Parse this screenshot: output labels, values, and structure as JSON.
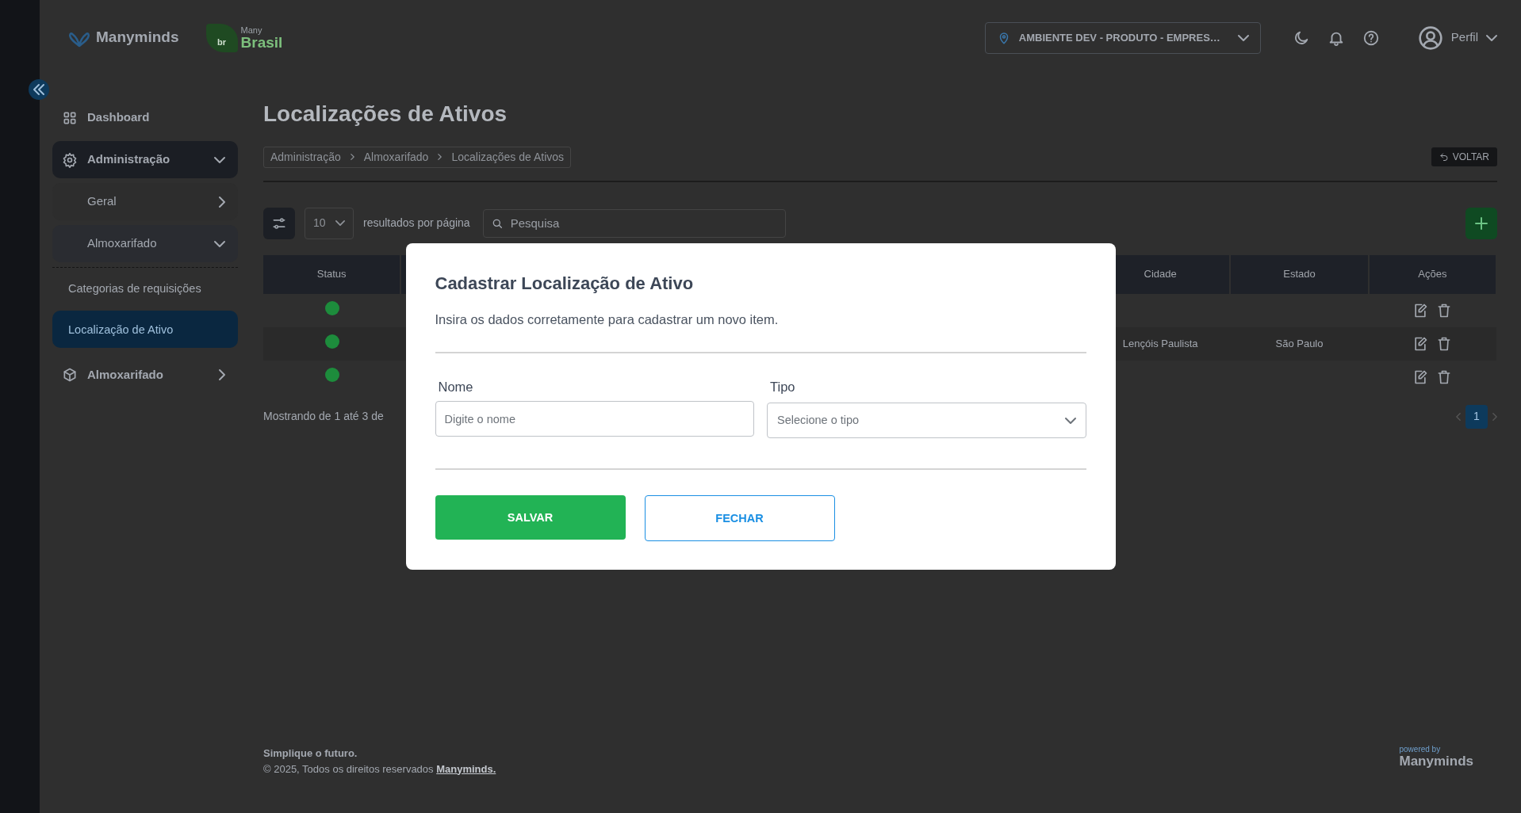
{
  "header": {
    "logo": "Manyminds",
    "partner_logo": {
      "badge": "br",
      "small": "Many",
      "main": "Brasil"
    },
    "environment": "AMBIENTE DEV - PRODUTO - EMPRES…",
    "profile": "Perfil"
  },
  "sidebar": {
    "items": [
      {
        "label": "Dashboard",
        "kind": "link"
      },
      {
        "label": "Administração",
        "kind": "group",
        "expanded": true,
        "children": [
          {
            "label": "Geral",
            "kind": "group",
            "expanded": false
          },
          {
            "label": "Almoxarifado",
            "kind": "group",
            "expanded": true,
            "children": [
              {
                "label": "Categorias de requisições",
                "kind": "leaf",
                "selected": false
              },
              {
                "label": "Localização de Ativo",
                "kind": "leaf",
                "selected": true
              }
            ]
          }
        ]
      },
      {
        "label": "Almoxarifado",
        "kind": "group",
        "expanded": false
      }
    ]
  },
  "page": {
    "title": "Localizações de Ativos",
    "breadcrumb": [
      "Administração",
      "Almoxarifado",
      "Localizações de Ativos"
    ],
    "back_button": "VOLTAR"
  },
  "toolbar": {
    "page_size": "10",
    "page_size_label": "resultados por página",
    "search": {
      "placeholder": "Pesquisa"
    }
  },
  "table": {
    "columns": [
      {
        "label": "Status",
        "kind": "status"
      },
      {
        "kind": "hidden"
      },
      {
        "label": "Cidade",
        "kind": "text"
      },
      {
        "label": "Estado",
        "kind": "text"
      },
      {
        "label": "Ações",
        "kind": "actions"
      }
    ],
    "rows": [
      {
        "active": true,
        "cidade": "",
        "estado": ""
      },
      {
        "active": true,
        "cidade": "Lençóis Paulista",
        "estado": "São Paulo"
      },
      {
        "active": true,
        "cidade": "",
        "estado": ""
      }
    ]
  },
  "pagination": {
    "summary": "Mostrando de 1 até 3 de",
    "pages": [
      {
        "label": "1",
        "selected": true
      }
    ]
  },
  "footer": {
    "tagline": "Simplique o futuro.",
    "copyright": "© 2025, Todos os direitos reservados",
    "company_link": "Manyminds.",
    "powered_by": "powered by",
    "powered_brand": "Manyminds"
  },
  "modal": {
    "title": "Cadastrar Localização de Ativo",
    "subtitle": "Insira os dados corretamente para cadastrar um novo item.",
    "fields": [
      {
        "label": "Nome",
        "kind": "text",
        "placeholder": "Digite o nome"
      },
      {
        "label": "Tipo",
        "kind": "select",
        "placeholder": "Selecione o tipo"
      }
    ],
    "buttons": [
      {
        "label": "SALVAR",
        "kind": "primary"
      },
      {
        "label": "FECHAR",
        "kind": "outline"
      }
    ]
  }
}
